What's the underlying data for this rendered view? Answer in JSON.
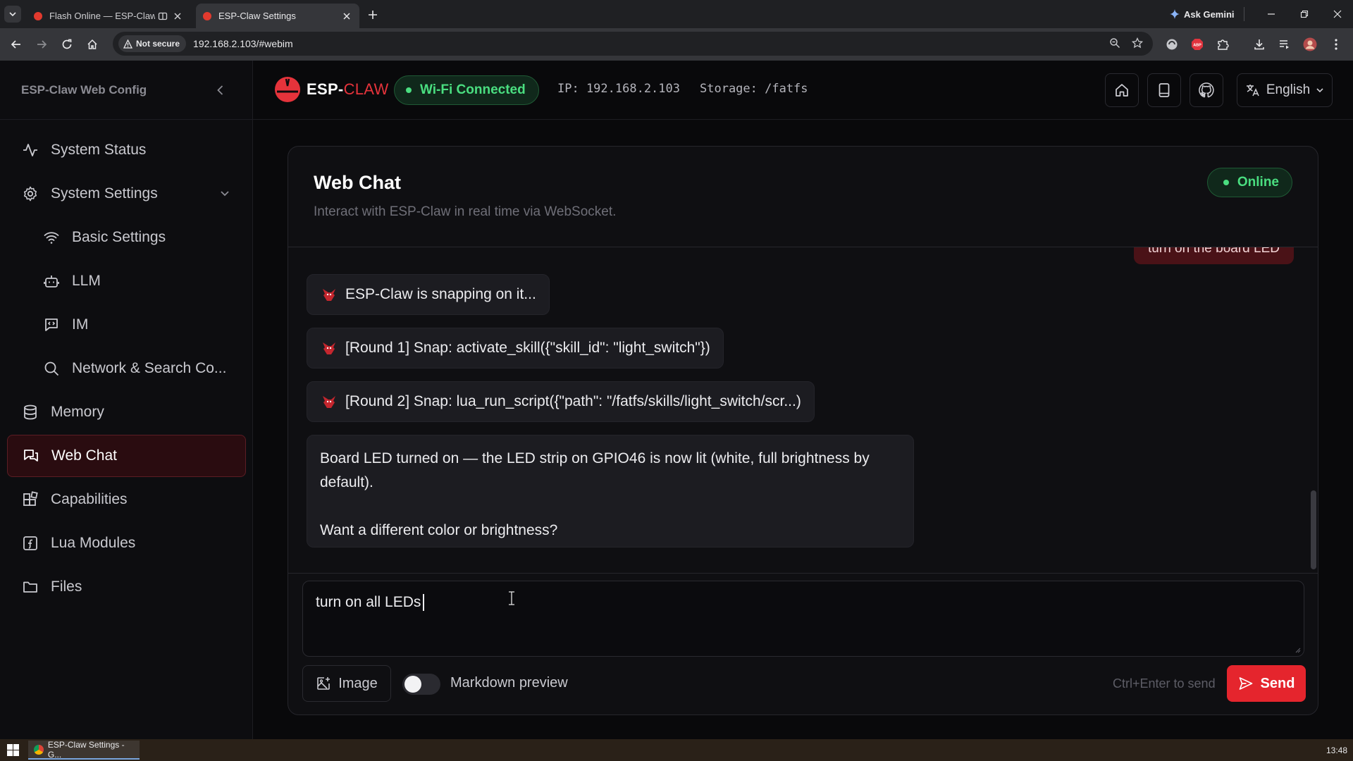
{
  "browser": {
    "tabs": [
      {
        "title": "Flash Online — ESP-Claw"
      },
      {
        "title": "ESP-Claw Settings"
      }
    ],
    "ask_gemini": "Ask Gemini",
    "security_label": "Not secure",
    "url": "192.168.2.103/#webim"
  },
  "sidebar": {
    "title": "ESP-Claw Web Config",
    "items": [
      {
        "label": "System Status",
        "icon": "activity-icon"
      },
      {
        "label": "System Settings",
        "icon": "gear-icon"
      },
      {
        "label": "Basic Settings",
        "icon": "wifi-icon"
      },
      {
        "label": "LLM",
        "icon": "bot-icon"
      },
      {
        "label": "IM",
        "icon": "message-code-icon"
      },
      {
        "label": "Network & Search Co...",
        "icon": "search-icon"
      },
      {
        "label": "Memory",
        "icon": "database-icon"
      },
      {
        "label": "Web Chat",
        "icon": "chat-icon"
      },
      {
        "label": "Capabilities",
        "icon": "blocks-icon"
      },
      {
        "label": "Lua Modules",
        "icon": "function-icon"
      },
      {
        "label": "Files",
        "icon": "folder-icon"
      }
    ],
    "active": "Web Chat"
  },
  "topbar": {
    "logo_main": "ESP-",
    "logo_accent": "CLAW",
    "wifi_status": "Wi-Fi Connected",
    "ip": "IP: 192.168.2.103",
    "storage": "Storage: /fatfs",
    "language": "English"
  },
  "chat": {
    "title": "Web Chat",
    "subtitle": "Interact with ESP-Claw in real time via WebSocket.",
    "status": "Online",
    "user_message_partial": "turn on the board LED",
    "messages": [
      "ESP-Claw is snapping on it...",
      "[Round 1] Snap: activate_skill({\"skill_id\": \"light_switch\"})",
      "[Round 2] Snap: lua_run_script({\"path\": \"/fatfs/skills/light_switch/scr...)"
    ],
    "reply_line1": "Board LED turned on — the LED strip on GPIO46 is now lit (white, full brightness by default).",
    "reply_line2": "Want a different color or brightness?",
    "composer_value": "turn on all LEDs",
    "image_button": "Image",
    "markdown_preview": "Markdown preview",
    "markdown_enabled": false,
    "hint": "Ctrl+Enter to send",
    "send_button": "Send"
  },
  "taskbar": {
    "task_label": "ESP-Claw Settings - G...",
    "clock": "13:48"
  },
  "colors": {
    "accent": "#e5252d",
    "success": "#4ade80",
    "background": "#09090b"
  }
}
